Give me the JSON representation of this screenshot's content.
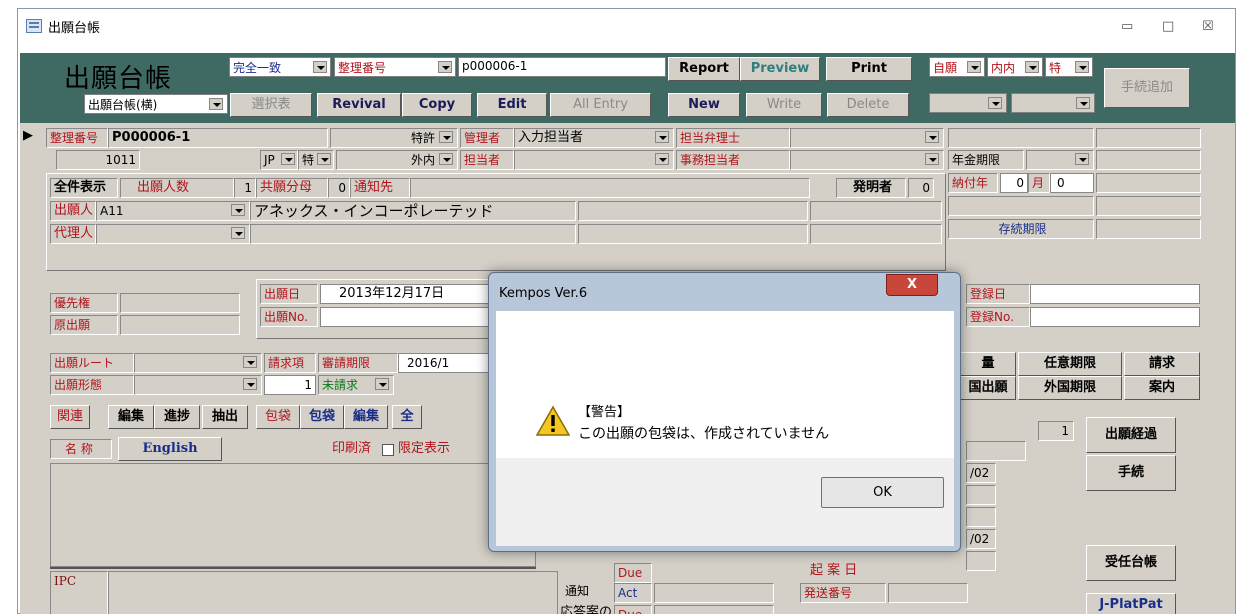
{
  "window": {
    "title": "出願台帳",
    "min": "▭",
    "max": "□",
    "close": "☒"
  },
  "header": {
    "big_title": "出願台帳",
    "view_select": "出願台帳(横)",
    "match_select": "完全一致",
    "field_select": "整理番号",
    "search_value": "p000006-1",
    "btn_select_table": "選択表",
    "btn_revival": "Revival",
    "btn_copy": "Copy",
    "btn_edit": "Edit",
    "btn_all_entry": "All Entry",
    "btn_report": "Report",
    "btn_preview": "Preview",
    "btn_print": "Print",
    "btn_new": "New",
    "btn_write": "Write",
    "btn_delete": "Delete",
    "filter1": "自願",
    "filter2": "内内",
    "filter3": "特",
    "btn_proc_add": "手続追加"
  },
  "record": {
    "ref_label": "整理番号",
    "ref_value": "P000006-1",
    "num": "1011",
    "type": "特許",
    "country": "JP",
    "kind": "特",
    "domestic": "外内",
    "manager_label": "管理者",
    "manager_value": "入力担当者",
    "attorney_label": "担当弁理士",
    "staff_label": "担当者",
    "clerk_label": "事務担当者",
    "annuity_label": "年金期限",
    "paid_year_label": "納付年",
    "paid_year_value": "0",
    "paid_month_label": "月",
    "paid_month_value": "0",
    "survival_label": "存続期限"
  },
  "applicant": {
    "show_all": "全件表示",
    "applicant_count_label": "出願人数",
    "applicant_count": "1",
    "share_label": "共願分母",
    "share": "0",
    "notice_label": "通知先",
    "inventor_label": "発明者",
    "inventor_count": "0",
    "applicant_label": "出願人",
    "applicant_code": "A11",
    "applicant_name": "アネックス・インコーポレーテッド",
    "agent_label": "代理人"
  },
  "filing": {
    "priority_label": "優先権",
    "original_label": "原出願",
    "date_label": "出願日",
    "date_value": "2013年12月17日",
    "no_label": "出願No.",
    "reg_date_label": "登録日",
    "reg_no_label": "登録No."
  },
  "route": {
    "route_label": "出願ルート",
    "form_label": "出願形態",
    "claims_label": "請求項",
    "claims_value": "1",
    "exam_label": "審請期限",
    "exam_value": "2016/1",
    "unrequested": "未請求",
    "tab_amount": "量",
    "tab_optional": "任意期限",
    "tab_claim": "請求",
    "tab_foreign": "国出願",
    "tab_foreign_due": "外国期限",
    "tab_guide": "案内"
  },
  "tabs": {
    "related": "関連",
    "edit": "編集",
    "progress": "進捗",
    "extract": "抽出",
    "wrap": "包袋",
    "wrap2": "包袋",
    "edit2": "編集",
    "all": "全"
  },
  "title_row": {
    "name_label": "名 称",
    "english": "English",
    "printed": "印刷済",
    "limited": "限定表示"
  },
  "lower": {
    "ipc": "IPC",
    "notice": "通知",
    "due": "Due",
    "act": "Act",
    "reply_label": "応答案の",
    "due2": "Due",
    "send_no": "発送番号",
    "draft": "起 案 日",
    "date_a": "/02",
    "date_b": "/02",
    "counter": "1"
  },
  "right_buttons": {
    "history": "出願経過",
    "procedure": "手続",
    "acceptance": "受任台帳",
    "jplat": "J-PlatPat"
  },
  "dialog": {
    "title": "Kempos Ver.6",
    "close": "X",
    "heading": "【警告】",
    "message": "この出願の包袋は、作成されていません",
    "ok": "OK"
  }
}
